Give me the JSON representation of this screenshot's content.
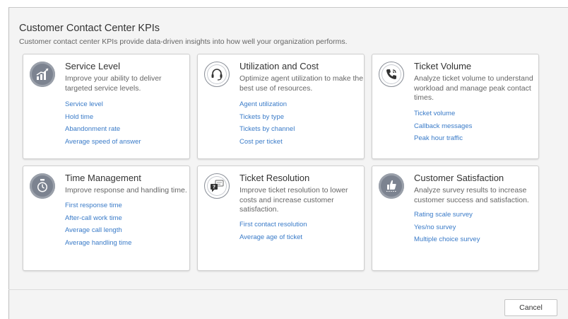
{
  "header": {
    "title": "Customer Contact Center KPIs",
    "subtitle": "Customer contact center KPIs provide data-driven insights into how well your organization performs."
  },
  "cards": [
    {
      "title": "Service Level",
      "description": "Improve your ability to deliver targeted service levels.",
      "icon": "chart-icon",
      "links": [
        "Service level",
        "Hold time",
        "Abandonment rate",
        "Average speed of answer"
      ]
    },
    {
      "title": "Utilization and Cost",
      "description": "Optimize agent utilization to make the best use of resources.",
      "icon": "headset-icon",
      "links": [
        "Agent utilization",
        "Tickets by type",
        "Tickets by channel",
        "Cost per ticket"
      ]
    },
    {
      "title": "Ticket Volume",
      "description": "Analyze ticket volume to understand workload and manage peak contact times.",
      "icon": "phone-icon",
      "links": [
        "Ticket volume",
        "Callback messages",
        "Peak hour traffic"
      ]
    },
    {
      "title": "Time Management",
      "description": "Improve response and handling time.",
      "icon": "stopwatch-icon",
      "links": [
        "First response time",
        "After-call work time",
        "Average call length",
        "Average handling time"
      ]
    },
    {
      "title": "Ticket Resolution",
      "description": "Improve ticket resolution to lower costs and increase customer satisfaction.",
      "icon": "chat-question-icon",
      "links": [
        "First contact resolution",
        "Average age of ticket"
      ]
    },
    {
      "title": "Customer Satisfaction",
      "description": "Analyze survey results to increase customer success and satisfaction.",
      "icon": "thumbs-up-icon",
      "links": [
        "Rating scale survey",
        "Yes/no survey",
        "Multiple choice survey"
      ]
    }
  ],
  "footer": {
    "cancel_label": "Cancel"
  },
  "colors": {
    "link": "#3a7bc8",
    "icon_fill": "#7c8390",
    "panel_bg": "#f4f4f4"
  }
}
